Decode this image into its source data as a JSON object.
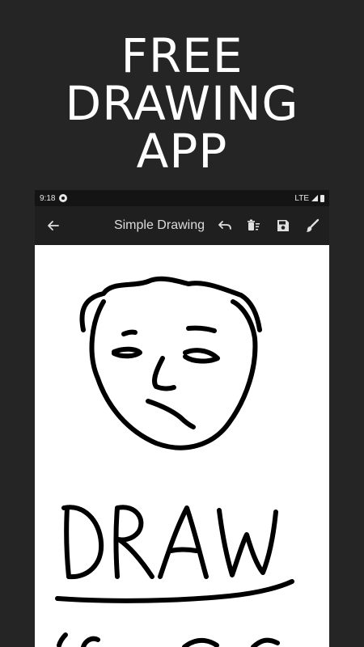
{
  "promo": {
    "line1": "FREE",
    "line2": "DRAWING",
    "line3": "APP"
  },
  "status_bar": {
    "time": "9:18",
    "network": "LTE"
  },
  "toolbar": {
    "title": "Simple Drawing",
    "back_icon": "arrow-back-icon",
    "undo_icon": "undo-icon",
    "clear_icon": "clear-all-icon",
    "save_icon": "save-icon",
    "brush_icon": "brush-icon"
  },
  "canvas": {
    "drawn_text": "DRAW",
    "background_color": "#ffffff",
    "stroke_color": "#000000"
  },
  "colors": {
    "page_background": "#252525",
    "toolbar": "#1f1f1f",
    "status_bar": "#141414"
  }
}
